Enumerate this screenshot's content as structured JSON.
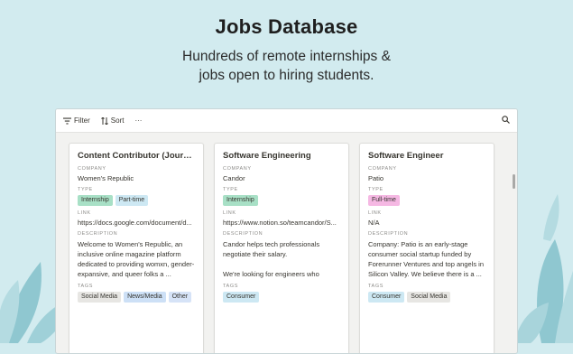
{
  "hero": {
    "title": "Jobs Database",
    "subtitle_line1": "Hundreds of remote internships &",
    "subtitle_line2": "jobs open to hiring students."
  },
  "toolbar": {
    "filter_label": "Filter",
    "sort_label": "Sort",
    "more_label": "···"
  },
  "labels": {
    "company": "COMPANY",
    "type": "TYPE",
    "link": "LINK",
    "description": "DESCRIPTION",
    "tags": "TAGS"
  },
  "colors": {
    "background": "#d2ebef",
    "tag_green": "#a8e0c6",
    "tag_blue": "#cde4f6",
    "tag_pink": "#f5b8e3",
    "tag_gray": "#e7e6e3"
  },
  "cards": [
    {
      "title": "Content Contributor (Journalism)",
      "company": "Women's Republic",
      "types": [
        {
          "label": "Internship",
          "color": "#a8e0c6"
        },
        {
          "label": "Part-time",
          "color": "#cde8f3"
        }
      ],
      "link": "https://docs.google.com/document/d...",
      "description": "Welcome to Women's Republic, an inclusive online magazine platform dedicated to providing womxn, gender-expansive, and queer folks a ...",
      "tags": [
        {
          "label": "Social Media",
          "color": "#e7e6e3"
        },
        {
          "label": "News/Media",
          "color": "#cde0f6"
        },
        {
          "label": "Other",
          "color": "#d6e3f7"
        }
      ]
    },
    {
      "title": "Software Engineering",
      "company": "Candor",
      "types": [
        {
          "label": "Internship",
          "color": "#a8e0c6"
        }
      ],
      "link": "https://www.notion.so/teamcandor/S...",
      "description": "Candor helps tech professionals negotiate their salary.\n\nWe're looking for engineers who want...",
      "tags": [
        {
          "label": "Consumer",
          "color": "#cde8f3"
        }
      ]
    },
    {
      "title": "Software Engineer",
      "company": "Patio",
      "types": [
        {
          "label": "Full-time",
          "color": "#f5b8e3"
        }
      ],
      "link": "N/A",
      "description": "Company: Patio is an early-stage consumer social startup funded by Forerunner Ventures and top angels in Silicon Valley.  We believe there is a ...",
      "tags": [
        {
          "label": "Consumer",
          "color": "#cde8f3"
        },
        {
          "label": "Social Media",
          "color": "#e7e6e3"
        }
      ]
    }
  ]
}
